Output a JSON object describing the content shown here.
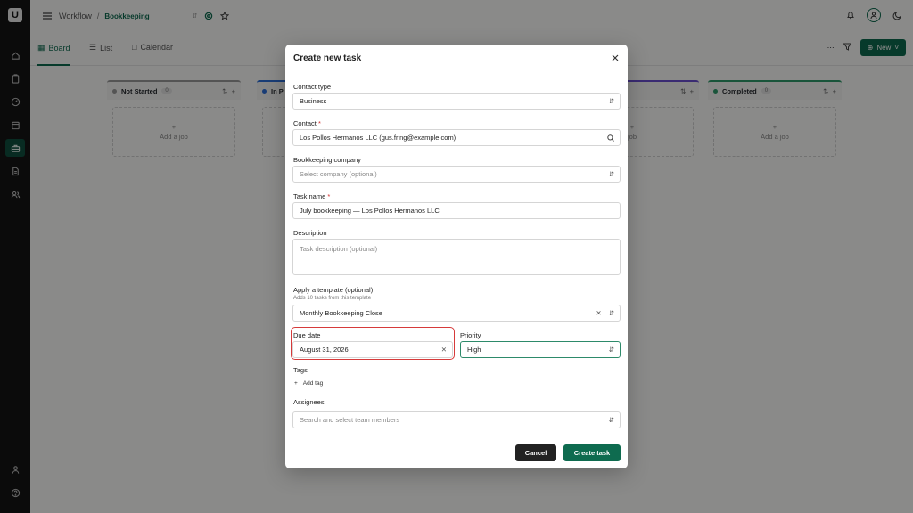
{
  "app": {
    "logo_letter": "U"
  },
  "breadcrumb": {
    "root": "Workflow",
    "separator": "/",
    "current": "Bookkeeping"
  },
  "views": [
    {
      "label": "Board",
      "active": true
    },
    {
      "label": "List"
    },
    {
      "label": "Calendar"
    }
  ],
  "toolbar": {
    "more": "⋯",
    "new_label": "New"
  },
  "columns": [
    {
      "title": "Not Started",
      "count": "0",
      "add_label": "Add a job",
      "color": "#999999"
    },
    {
      "title": "In P",
      "count": "",
      "add_label": "",
      "color": "#2f6fd8"
    },
    {
      "title": "",
      "count": "",
      "add_label": "job",
      "color": "#6b4fcf"
    },
    {
      "title": "Completed",
      "count": "0",
      "add_label": "Add a job",
      "color": "#2e9a6a"
    }
  ],
  "modal": {
    "title": "Create new task",
    "contact_type": {
      "label": "Contact type",
      "value": "Business"
    },
    "contact": {
      "label": "Contact",
      "required_mark": "*",
      "value": "Los Pollos Hermanos LLC (gus.fring@example.com)"
    },
    "bookkeeping_company": {
      "label": "Bookkeeping company",
      "placeholder": "Select company (optional)"
    },
    "task_name": {
      "label": "Task name",
      "required_mark": "*",
      "value": "July bookkeeping — Los Pollos Hermanos LLC"
    },
    "description": {
      "label": "Description",
      "placeholder": "Task description (optional)"
    },
    "template": {
      "label": "Apply a template (optional)",
      "hint": "Adds 10 tasks from this template",
      "value": "Monthly Bookkeeping Close"
    },
    "due_date": {
      "label": "Due date",
      "value": "August 31, 2026"
    },
    "priority": {
      "label": "Priority",
      "value": "High"
    },
    "tags": {
      "label": "Tags",
      "add_label": "Add tag"
    },
    "assignees": {
      "label": "Assignees",
      "placeholder": "Search and select team members"
    },
    "cancel_label": "Cancel",
    "create_label": "Create task"
  },
  "colors": {
    "brand": "#0e6b4f",
    "highlight": "#d63a3a",
    "rail": "#141414"
  }
}
